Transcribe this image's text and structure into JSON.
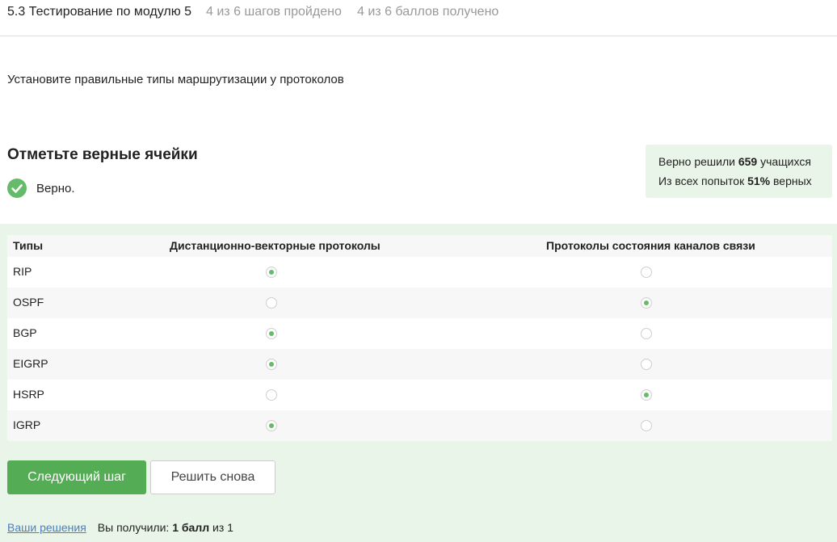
{
  "header": {
    "title": "5.3 Тестирование по модулю 5",
    "steps_progress": "4 из 6 шагов пройдено",
    "points_progress": "4 из 6 баллов  получено"
  },
  "question": "Установите правильные типы маршрутизации у протоколов",
  "section_title": "Отметьте верные ячейки",
  "verdict": {
    "text": "Верно.",
    "icon": "check-circle-icon"
  },
  "stats": {
    "solved_prefix": "Верно решили ",
    "solved_count": "659",
    "solved_suffix": " учащихся",
    "attempts_prefix": "Из всех попыток ",
    "attempts_percent": "51%",
    "attempts_suffix": " верных"
  },
  "table": {
    "headers": {
      "type": "Типы",
      "distance_vector": "Дистанционно-векторные протоколы",
      "link_state": "Протоколы состояния каналов связи"
    },
    "rows": [
      {
        "name": "RIP",
        "selected": "distance_vector"
      },
      {
        "name": "OSPF",
        "selected": "link_state"
      },
      {
        "name": "BGP",
        "selected": "distance_vector"
      },
      {
        "name": "EIGRP",
        "selected": "distance_vector"
      },
      {
        "name": "HSRP",
        "selected": "link_state"
      },
      {
        "name": "IGRP",
        "selected": "distance_vector"
      }
    ]
  },
  "buttons": {
    "next": "Следующий шаг",
    "retry": "Решить снова"
  },
  "footer": {
    "solutions_link": "Ваши решения",
    "got_prefix": "Вы получили: ",
    "got_points": "1 балл",
    "got_suffix": " из 1"
  },
  "colors": {
    "accent": "#54ad54",
    "success_bg": "#e8f5e8",
    "link": "#4a7fc1"
  }
}
